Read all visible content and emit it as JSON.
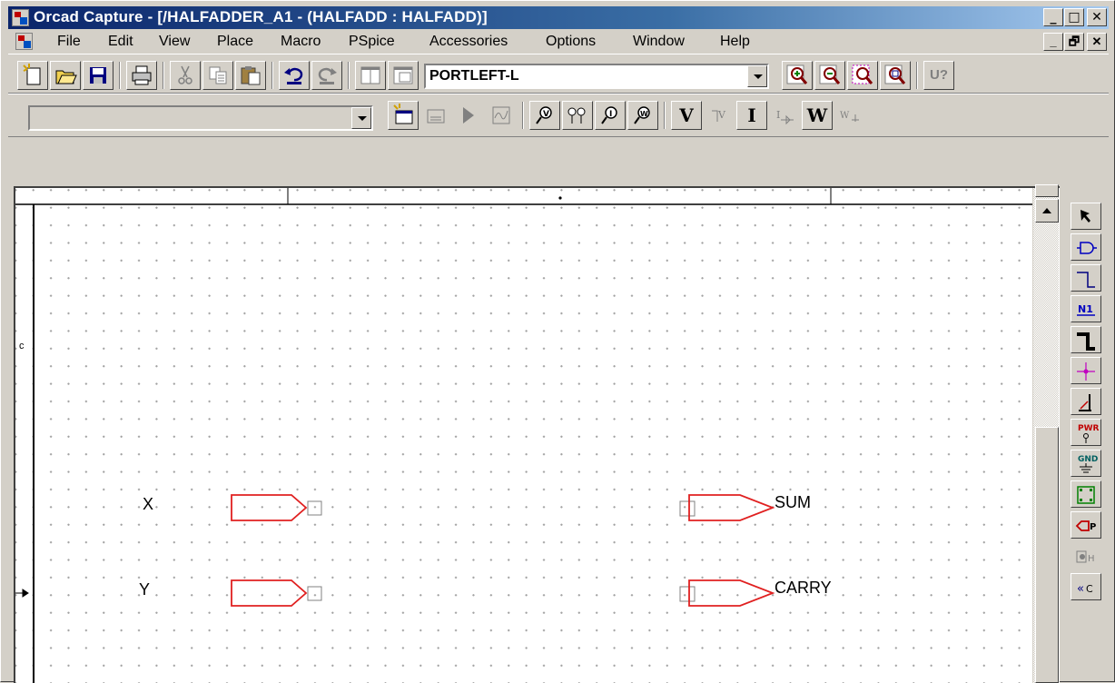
{
  "window": {
    "title": "Orcad Capture - [/HALFADDER_A1 - (HALFADD : HALFADD)]",
    "caption_buttons": [
      "_",
      "□",
      "✕"
    ]
  },
  "menubar": {
    "items": [
      "File",
      "Edit",
      "View",
      "Place",
      "Macro",
      "PSpice",
      "Accessories",
      "Options",
      "Window",
      "Help"
    ],
    "doc_buttons": [
      "_",
      "🗗",
      "✕"
    ]
  },
  "toolbar1": {
    "part_combo_value": "PORTLEFT-L",
    "buttons": [
      "new-icon",
      "open-icon",
      "save-icon",
      "print-icon",
      "cut-icon",
      "copy-icon",
      "paste-icon",
      "undo-icon",
      "redo-icon",
      "cascade-icon",
      "tile-icon",
      "zoom-in-icon",
      "zoom-out-icon",
      "zoom-area-icon",
      "zoom-all-icon",
      "annotate-icon"
    ],
    "last_button_label": "U?"
  },
  "toolbar2": {
    "profile_combo_value": "",
    "text_buttons": {
      "voltage": "V",
      "current": "I",
      "power": "W"
    }
  },
  "schematic": {
    "left_marker": "c",
    "input_ports": [
      {
        "label": "X"
      },
      {
        "label": "Y"
      }
    ],
    "output_ports": [
      {
        "label": "SUM"
      },
      {
        "label": "CARRY"
      }
    ],
    "line_color": "#e02020"
  },
  "palette": {
    "buttons": [
      {
        "name": "select-tool",
        "label": ""
      },
      {
        "name": "place-part",
        "label": ""
      },
      {
        "name": "place-wire",
        "label": ""
      },
      {
        "name": "place-net-alias",
        "label": "N1"
      },
      {
        "name": "place-bus",
        "label": ""
      },
      {
        "name": "place-junction",
        "label": ""
      },
      {
        "name": "place-bus-entry",
        "label": ""
      },
      {
        "name": "place-power",
        "label": "PWR"
      },
      {
        "name": "place-ground",
        "label": "GND"
      },
      {
        "name": "place-hierarchical-block",
        "label": ""
      },
      {
        "name": "place-port",
        "label": "P"
      },
      {
        "name": "place-hierarchical-pin",
        "label": "H"
      },
      {
        "name": "place-off-page-connector",
        "label": "C"
      }
    ]
  }
}
